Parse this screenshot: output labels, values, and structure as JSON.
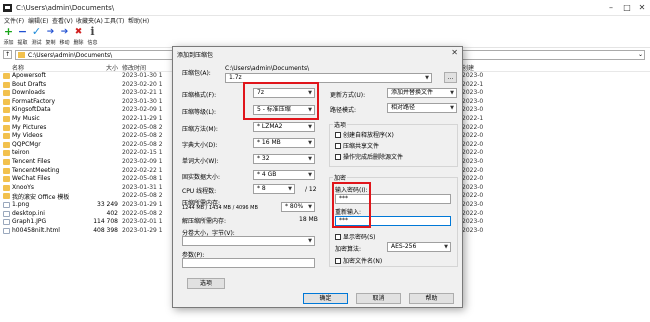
{
  "window": {
    "title": "C:\\Users\\admin\\Documents\\",
    "menu": [
      "文件(F)",
      "编辑(E)",
      "查看(V)",
      "收藏夹(A)",
      "工具(T)",
      "帮助(H)"
    ]
  },
  "toolbar": [
    {
      "label": "添加",
      "icon": "plus-icon",
      "symbol": "+",
      "color": "#1aa51a"
    },
    {
      "label": "提取",
      "icon": "minus-icon",
      "symbol": "−",
      "color": "#1f4fd1"
    },
    {
      "label": "测试",
      "icon": "check-icon",
      "symbol": "✓",
      "color": "#1c8ad9"
    },
    {
      "label": "复制",
      "icon": "copy-arrow-icon",
      "symbol": "➔",
      "color": "#1f4fd1"
    },
    {
      "label": "移动",
      "icon": "move-arrow-icon",
      "symbol": "➔",
      "color": "#1f4fd1"
    },
    {
      "label": "删除",
      "icon": "delete-icon",
      "symbol": "✖",
      "color": "#d11f1f"
    },
    {
      "label": "信息",
      "icon": "info-icon",
      "symbol": "i",
      "color": "#444444"
    }
  ],
  "address": "C:\\Users\\admin\\Documents\\",
  "columns": {
    "name": "名称",
    "size": "大小",
    "modified": "修改时间",
    "created": "创建"
  },
  "files": [
    {
      "name": "Apowersoft",
      "size": "",
      "date": "2023-01-30 1",
      "type": "folder"
    },
    {
      "name": "Bout Drafts",
      "size": "",
      "date": "2023-02-20 1",
      "type": "folder"
    },
    {
      "name": "Downloads",
      "size": "",
      "date": "2023-02-21 1",
      "type": "folder"
    },
    {
      "name": "FormatFactory",
      "size": "",
      "date": "2023-01-30 1",
      "type": "folder"
    },
    {
      "name": "KingsoftData",
      "size": "",
      "date": "2023-02-09 1",
      "type": "folder"
    },
    {
      "name": "My Music",
      "size": "",
      "date": "2022-11-29 1",
      "type": "folder"
    },
    {
      "name": "My Pictures",
      "size": "",
      "date": "2022-05-08 2",
      "type": "folder"
    },
    {
      "name": "My Videos",
      "size": "",
      "date": "2022-05-08 2",
      "type": "folder"
    },
    {
      "name": "QQPCMgr",
      "size": "",
      "date": "2022-05-08 2",
      "type": "folder"
    },
    {
      "name": "teiron",
      "size": "",
      "date": "2022-02-15 1",
      "type": "folder"
    },
    {
      "name": "Tencent Files",
      "size": "",
      "date": "2023-02-09 1",
      "type": "folder"
    },
    {
      "name": "TencentMeeting",
      "size": "",
      "date": "2022-02-22 1",
      "type": "folder"
    },
    {
      "name": "WeChat Files",
      "size": "",
      "date": "2022-05-08 1",
      "type": "folder"
    },
    {
      "name": "XnooYs",
      "size": "",
      "date": "2023-01-31 1",
      "type": "folder"
    },
    {
      "name": "我的滚安 Office 模板",
      "size": "",
      "date": "2022-05-08 2",
      "type": "folder"
    },
    {
      "name": "1.png",
      "size": "33 249",
      "date": "2023-01-29 1",
      "type": "file"
    },
    {
      "name": "desktop.ini",
      "size": "402",
      "date": "2022-05-08 2",
      "type": "file"
    },
    {
      "name": "Graph1.JPG",
      "size": "114 708",
      "date": "2023-02-01 1",
      "type": "file"
    },
    {
      "name": "h00458nilt.html",
      "size": "408 398",
      "date": "2023-01-29 1",
      "type": "file"
    }
  ],
  "right_modified": [
    "2023-0",
    "2022-1",
    "2023-0",
    "2023-0",
    "2023-0",
    "2022-1",
    "2022-0",
    "2022-0",
    "2022-0",
    "2022-0",
    "2023-0",
    "2022-0",
    "2022-0",
    "2023-0",
    "2022-0",
    "2023-0",
    "2022-0",
    "2023-0",
    "2023-0"
  ],
  "watermark": "",
  "dialog": {
    "title": "添加到压缩包",
    "archive_label": "压缩包(A):",
    "archive_dir": "C:\\Users\\admin\\Documents\\",
    "archive_name": "1.7z",
    "browse": "...",
    "format_label": "压缩格式(F):",
    "format_value": "7z",
    "level_label": "压缩等级(L):",
    "level_value": "5 - 标准压缩",
    "method_label": "压缩方法(M):",
    "method_value": "* LZMA2",
    "dict_label": "字典大小(D):",
    "dict_value": "* 16 MB",
    "word_label": "单词大小(W):",
    "word_value": "* 32",
    "solid_label": "固实数据大小:",
    "solid_value": "* 4 GB",
    "threads_label": "CPU 线程数:",
    "threads_value": "* 8",
    "threads_total": "/ 12",
    "mem_label": "压缩所需内存:",
    "mem_value": "1244 MB / 1434 MB / 4096 MB",
    "mem_percent": "* 80%",
    "decomp_label": "解压缩所需内存:",
    "decomp_value": "18 MB",
    "split_label": "分卷大小，字节(V):",
    "params_label": "参数(P):",
    "options_btn": "选项",
    "update_label": "更新方式(U):",
    "update_value": "添加并替换文件",
    "path_label": "路径模式:",
    "path_value": "相对路径",
    "options_group": "选项",
    "opt1": "创建自释放程序(X)",
    "opt2": "压缩共享文件",
    "opt3": "操作完成后删除源文件",
    "encrypt_group": "加密",
    "pwd_label": "输入密码(I):",
    "pwd_value": "***",
    "repwd_label": "重新输入:",
    "repwd_value": "***",
    "show_pwd": "显示密码(S)",
    "enc_method_label": "加密算法:",
    "enc_method_value": "AES-256",
    "enc_names": "加密文件名(N)",
    "ok": "确定",
    "cancel": "取消",
    "help": "帮助"
  }
}
